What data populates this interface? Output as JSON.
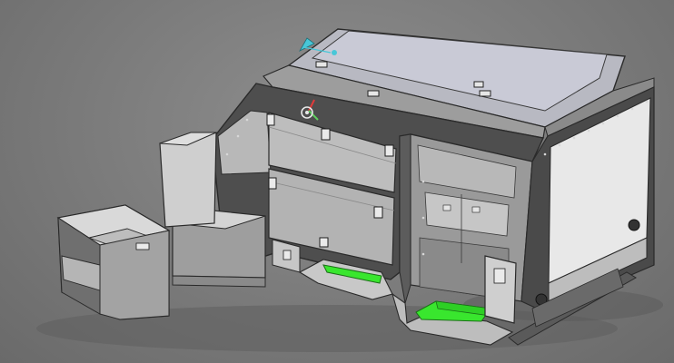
{
  "viewport": {
    "background_color": "#7d7d7d",
    "shadow_color": "#5e5e5e"
  },
  "model": {
    "panel_light": "#d8d8d8",
    "panel_mid": "#bdbdbd",
    "panel_dark": "#8a8a8a",
    "frame_dark": "#4e4e4e",
    "edge_line": "#2a2a2a",
    "lid_glass": "#c9cad6",
    "highlight_green": "#39e62e"
  },
  "gizmo": {
    "icons": [
      "move-gizmo-icon",
      "rotate-gizmo-icon"
    ],
    "axis_colors": {
      "x": "#e03a3a",
      "y": "#5fd05f",
      "z": "#48c7d8"
    }
  }
}
